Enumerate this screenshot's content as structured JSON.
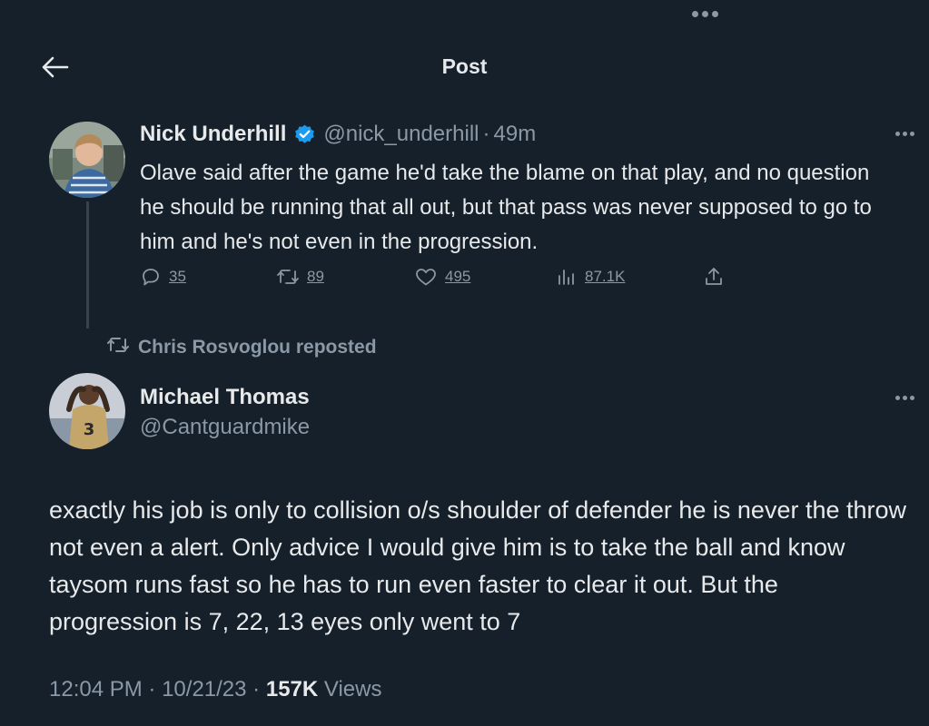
{
  "header": {
    "title": "Post"
  },
  "quoted_tweet": {
    "author_name": "Nick Underhill",
    "handle": "@nick_underhill",
    "separator": "·",
    "time": "49m",
    "text": "Olave said after the game he'd take the blame on that play, and no question he should be running that all out, but that pass was never supposed to go to him and he's not even in the progression.",
    "stats": {
      "replies": "35",
      "reposts": "89",
      "likes": "495",
      "views": "87.1K"
    }
  },
  "repost_banner": {
    "text": "Chris Rosvoglou reposted"
  },
  "main_tweet": {
    "author_name": "Michael Thomas",
    "handle": "@Cantguardmike",
    "text": "exactly his job is only to collision o/s shoulder of defender he is never the throw not even a alert. Only advice I would give him is to take the ball and know taysom runs fast so he has to run even faster to clear it out. But the progression is 7, 22, 13 eyes only went to 7",
    "time": "12:04 PM",
    "date": "10/21/23",
    "separator": "·",
    "views_count": "157K",
    "views_label": "Views"
  },
  "icons": [
    "back-arrow-icon",
    "more-icon",
    "verified-badge-icon",
    "reply-icon",
    "repost-icon",
    "like-icon",
    "views-icon",
    "share-icon"
  ],
  "colors": {
    "background": "#15202b",
    "text_primary": "#e7e9ea",
    "text_secondary": "#8b98a5",
    "verified": "#1d9bf0",
    "thread_line": "#38444d"
  }
}
